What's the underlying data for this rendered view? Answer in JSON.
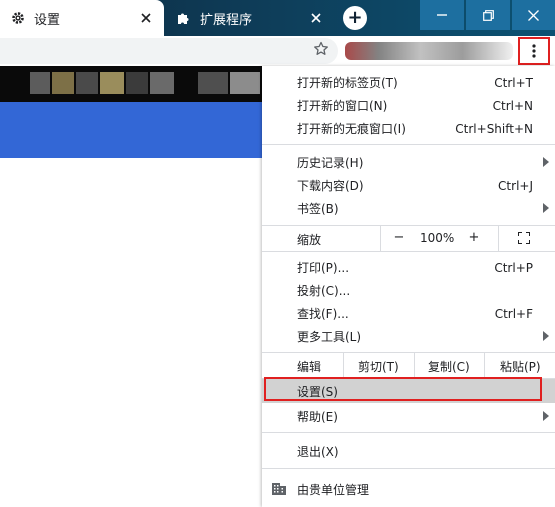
{
  "tabs": [
    {
      "label": "设置",
      "icon": "gear-icon",
      "active": true
    },
    {
      "label": "扩展程序",
      "icon": "puzzle-icon",
      "active": false
    }
  ],
  "window": {
    "new_tab": "+"
  },
  "menu": {
    "group1": [
      {
        "label": "打开新的标签页(T)",
        "shortcut": "Ctrl+T"
      },
      {
        "label": "打开新的窗口(N)",
        "shortcut": "Ctrl+N"
      },
      {
        "label": "打开新的无痕窗口(I)",
        "shortcut": "Ctrl+Shift+N"
      }
    ],
    "group2": [
      {
        "label": "历史记录(H)",
        "shortcut": ""
      },
      {
        "label": "下载内容(D)",
        "shortcut": "Ctrl+J"
      },
      {
        "label": "书签(B)",
        "shortcut": ""
      }
    ],
    "zoom": {
      "label": "缩放",
      "minus": "−",
      "value": "100%",
      "plus": "+"
    },
    "group3": [
      {
        "label": "打印(P)...",
        "shortcut": "Ctrl+P"
      },
      {
        "label": "投射(C)...",
        "shortcut": ""
      },
      {
        "label": "查找(F)...",
        "shortcut": "Ctrl+F"
      },
      {
        "label": "更多工具(L)",
        "shortcut": ""
      }
    ],
    "edit": {
      "label": "编辑",
      "cut": "剪切(T)",
      "copy": "复制(C)",
      "paste": "粘贴(P)"
    },
    "settings": "设置(S)",
    "help": "帮助(E)",
    "exit": "退出(X)",
    "managed": "由贵单位管理"
  },
  "colors": {
    "accent_red": "#e02020",
    "page_blue": "#3367d6",
    "highlight": "#d2d2d2"
  }
}
